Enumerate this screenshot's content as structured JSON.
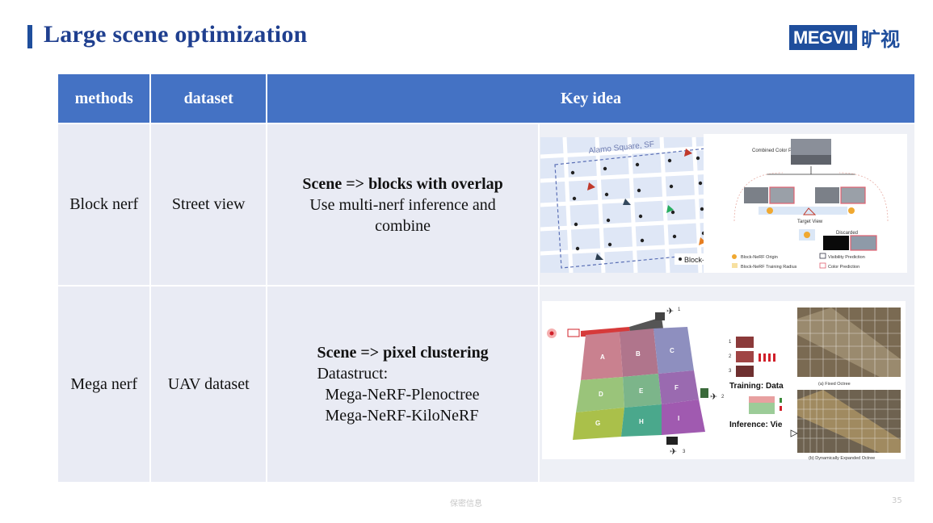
{
  "slide": {
    "title": "Large scene optimization",
    "logo_text": "MEGVII",
    "logo_cn": "旷视",
    "footer": "保密信息",
    "page_number": "35"
  },
  "table": {
    "headers": [
      "methods",
      "dataset",
      "Key idea"
    ],
    "rows": [
      {
        "method": "Block nerf",
        "dataset": "Street view",
        "idea_title": "Scene => blocks with overlap",
        "idea_lines": [
          "Use multi-nerf inference and",
          "combine"
        ]
      },
      {
        "method": "Mega nerf",
        "dataset": "UAV dataset",
        "idea_title": "Scene => pixel clustering",
        "idea_lines": [
          "Datastruct:",
          "Mega-NeRF-Plenoctree",
          "Mega-NeRF-KiloNeRF"
        ]
      }
    ]
  },
  "figures": {
    "block_nerf": {
      "map_label": "Alamo Square, SF",
      "legend_label": "Block-NeRF",
      "combined_label": "Combined Color Prediction",
      "target_view": "Target View",
      "discarded": "Discarded",
      "legend_items": [
        "Block-NeRF Origin",
        "Visibility Prediction",
        "Block-NeRF Training Radius",
        "Color Prediction"
      ]
    },
    "mega_nerf": {
      "cell_labels": [
        "A",
        "B",
        "C",
        "D",
        "E",
        "F",
        "G",
        "H",
        "I"
      ],
      "camera_labels": [
        "1",
        "2",
        "3"
      ],
      "training_label": "Training: Data",
      "inference_label": "Inference: Vie",
      "fixed_octree": "(a) Fixed Octree",
      "expanded_octree": "(b) Dynamically Expanded Octree",
      "index_labels": [
        "1",
        "2",
        "3"
      ]
    }
  }
}
